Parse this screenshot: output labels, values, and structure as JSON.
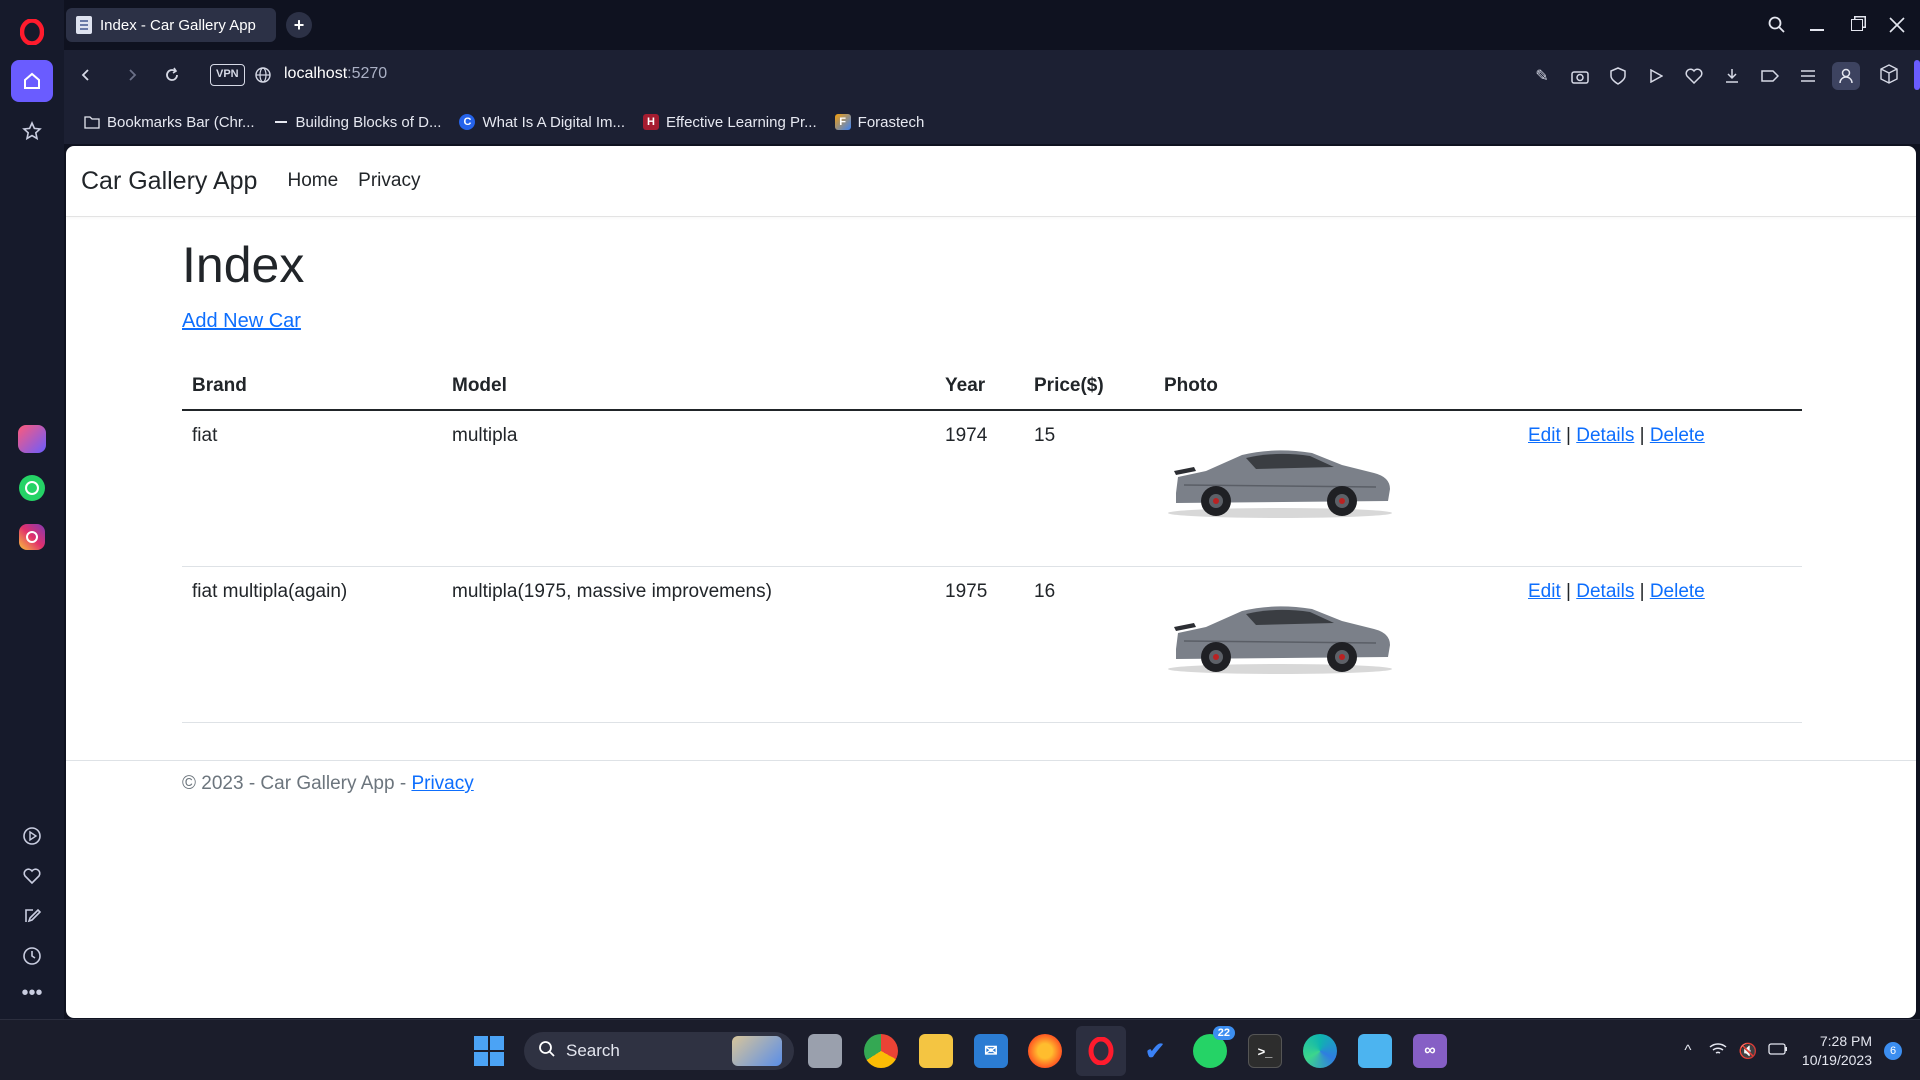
{
  "browser": {
    "tab_title": "Index - Car Gallery App",
    "url_host": "localhost",
    "url_port": ":5270",
    "vpn_label": "VPN",
    "bookmarks": [
      {
        "label": "Bookmarks Bar (Chr...",
        "icon": "folder-icon",
        "color": "#1c2033"
      },
      {
        "label": "Building Blocks of D...",
        "icon": "dash-icon",
        "color": "#1c2033"
      },
      {
        "label": "What Is A Digital Im...",
        "icon": "c-logo-icon",
        "color": "#2563eb"
      },
      {
        "label": "Effective Learning Pr...",
        "icon": "harvard-shield-icon",
        "color": "#a51c30"
      },
      {
        "label": "Forastech",
        "icon": "forastech-logo-icon",
        "color": "#f59e0b"
      }
    ]
  },
  "site": {
    "brand": "Car Gallery App",
    "nav": [
      "Home",
      "Privacy"
    ],
    "heading": "Index",
    "add_link": "Add New Car",
    "columns": [
      "Brand",
      "Model",
      "Year",
      "Price($)",
      "Photo"
    ],
    "rows": [
      {
        "brand": "fiat",
        "model": "multipla",
        "year": "1974",
        "price": "15",
        "photo": "car-photo"
      },
      {
        "brand": "fiat multipla(again)",
        "model": "multipla(1975, massive improvemens)",
        "year": "1975",
        "price": "16",
        "photo": "car-photo"
      }
    ],
    "actions": {
      "edit": "Edit",
      "details": "Details",
      "delete": "Delete",
      "sep": "|"
    },
    "footer_text": "© 2023 - Car Gallery App - ",
    "footer_link": "Privacy"
  },
  "taskbar": {
    "search_label": "Search",
    "whatsapp_badge": "22",
    "time": "7:28 PM",
    "date": "10/19/2023",
    "notifications": "6"
  },
  "colors": {
    "link": "#0d6efd",
    "opera_red": "#ff1b2d",
    "sidebar_accent": "#6a5cff"
  }
}
